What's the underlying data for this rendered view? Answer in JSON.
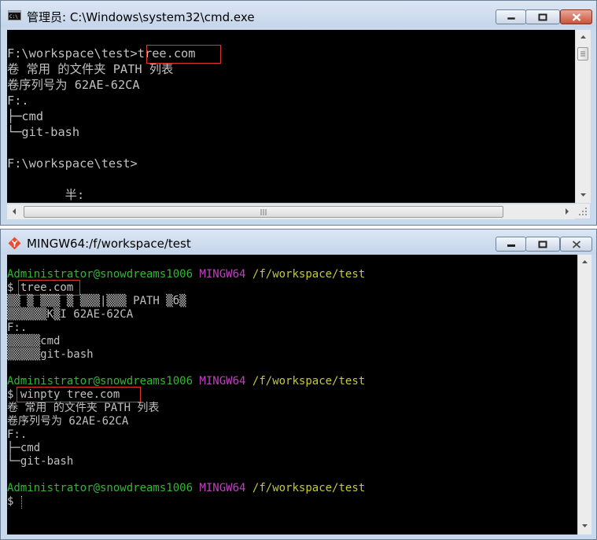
{
  "cmd_window": {
    "title": "管理员: C:\\Windows\\system32\\cmd.exe",
    "lines": [
      "F:\\workspace\\test>tree.com",
      "卷 常用 的文件夹 PATH 列表",
      "卷序列号为 62AE-62CA",
      "F:.",
      "├─cmd",
      "└─git-bash",
      "",
      "F:\\workspace\\test>",
      "",
      "        半:"
    ]
  },
  "mingw_window": {
    "title": "MINGW64:/f/workspace/test",
    "prompt": {
      "user_host": "Administrator@snowdreams1006",
      "env": "MINGW64",
      "path": "/f/workspace/test",
      "symbol": "$ "
    },
    "commands": [
      "tree.com",
      "winpty tree.com"
    ],
    "output_garbled": [
      "▒▒ ▒ ▒▒▒ ▒ ▒▒▒|▒▒▒ PATH ▒б▒",
      "▒▒▒▒▒▒K▒I 62AE-62CA",
      "F:.",
      "▒▒▒▒▒cmd",
      "▒▒▒▒▒git-bash"
    ],
    "output_winpty": [
      "卷 常用 的文件夹 PATH 列表",
      "卷序列号为 62AE-62CA",
      "F:.",
      "├─cmd",
      "└─git-bash"
    ]
  },
  "colors": {
    "prompt_user": "#2fb82f",
    "prompt_env": "#c040c0",
    "prompt_path": "#c7c73a",
    "highlight_box": "#e0352b"
  }
}
